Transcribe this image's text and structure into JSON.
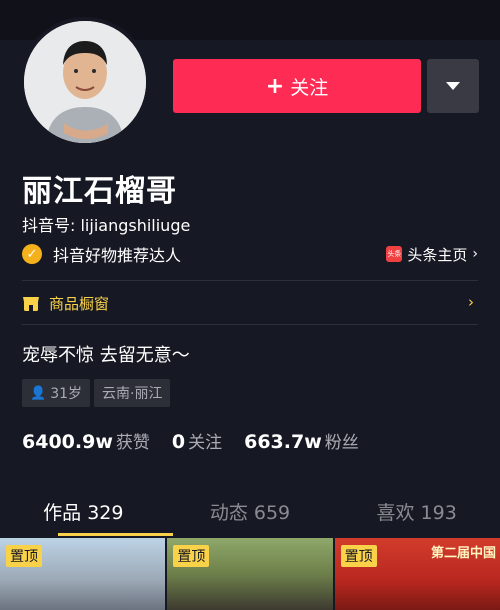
{
  "profile": {
    "nickname": "丽江石榴哥",
    "douyin_id": "抖音号: lijiangshiliuge",
    "verified_label": "抖音好物推荐达人",
    "toutiao_label": "头条主页",
    "toutiao_logo": "头条",
    "bio": "宠辱不惊 去留无意～",
    "age_tag": "31岁",
    "location_tag": "云南·丽江"
  },
  "actions": {
    "follow_label": "关注",
    "follow_icon": "plus-icon",
    "more_icon": "dropdown-triangle-icon"
  },
  "shop": {
    "label": "商品橱窗",
    "icon": "shop-icon"
  },
  "stats": [
    {
      "value": "6400.9w",
      "label": "获赞"
    },
    {
      "value": "0",
      "label": "关注"
    },
    {
      "value": "663.7w",
      "label": "粉丝"
    }
  ],
  "tabs": [
    {
      "label": "作品 329",
      "active": true
    },
    {
      "label": "动态 659",
      "active": false
    },
    {
      "label": "喜欢 193",
      "active": false
    }
  ],
  "videos": [
    {
      "pin_label": "置顶"
    },
    {
      "pin_label": "置顶"
    },
    {
      "pin_label": "置顶",
      "banner_text": "第二届中国"
    }
  ],
  "colors": {
    "background": "#161823",
    "follow_button": "#fe2c55",
    "accent_yellow": "#fad24a",
    "verified_badge": "#f5b11b"
  }
}
